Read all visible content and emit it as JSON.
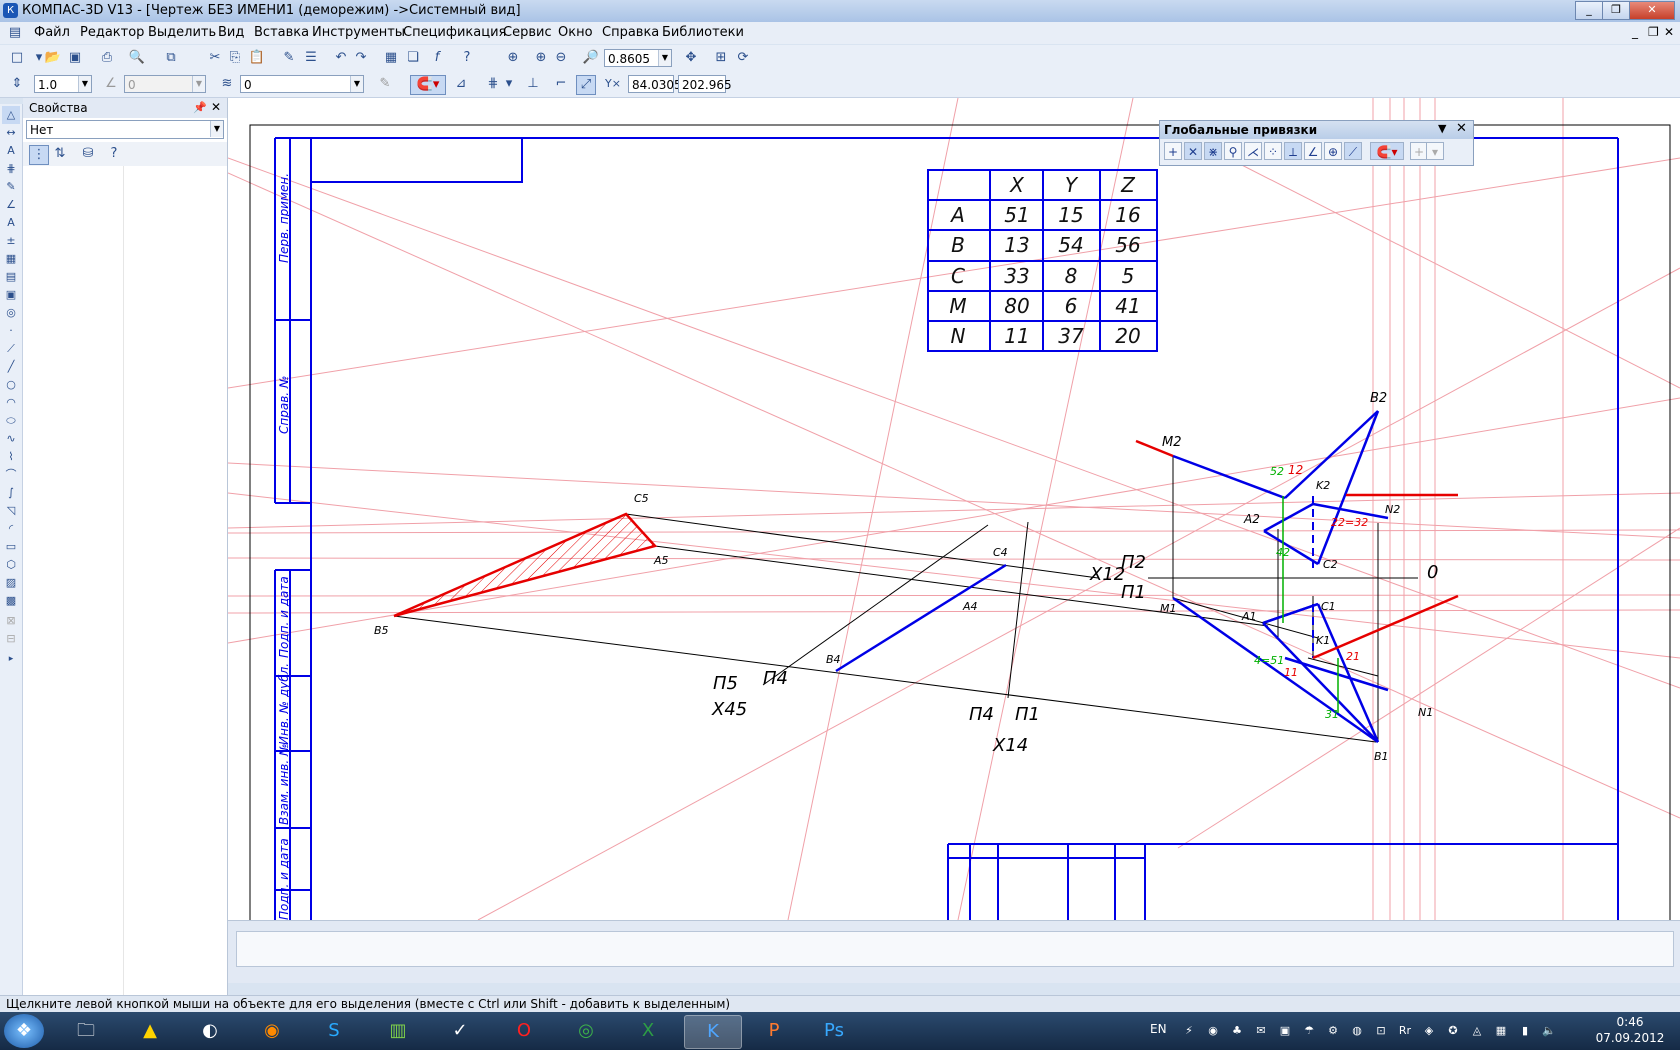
{
  "window": {
    "title": "КОМПАС-3D V13 - [Чертеж БЕЗ ИМЕНИ1 (деморежим) ->Системный вид]",
    "app_icon": "К",
    "buttons": [
      "_",
      "❐",
      "✕"
    ]
  },
  "menu": {
    "items": [
      "Файл",
      "Редактор",
      "Выделить",
      "Вид",
      "Вставка",
      "Инструменты",
      "Спецификация",
      "Сервис",
      "Окно",
      "Справка",
      "Библиотеки"
    ],
    "mdi_controls": [
      "_",
      "❐",
      "✕"
    ]
  },
  "toolbar_standard": {
    "zoom_value": "0.8605"
  },
  "toolbar_current": {
    "step_value": "1.0",
    "angle_value": "0",
    "layer_value": "0",
    "coord_x": "84.0305",
    "coord_y": "202.965",
    "coord_label": "Y"
  },
  "properties_panel": {
    "title": "Свойства",
    "combo_value": "Нет",
    "pin_icon": "ф",
    "close_icon": "✕"
  },
  "snap_panel": {
    "title": "Глобальные привязки"
  },
  "coord_table": {
    "headers": [
      "",
      "X",
      "Y",
      "Z"
    ],
    "rows": [
      [
        "A",
        "51",
        "15",
        "16"
      ],
      [
        "B",
        "13",
        "54",
        "56"
      ],
      [
        "C",
        "33",
        "8",
        "5"
      ],
      [
        "M",
        "80",
        "6",
        "41"
      ],
      [
        "N",
        "11",
        "37",
        "20"
      ]
    ]
  },
  "frame_labels": {
    "perv_primen": "Перв. примен.",
    "sprav": "Справ. №",
    "podp_data": "Подп. и дата",
    "inv_dubl": "Инв. № дубл.",
    "vzam_inv": "Взам. инв. №",
    "podp_data2": "Подп. и дата"
  },
  "drawing_labels": {
    "B2": "B2",
    "M2": "M2",
    "K2": "K2",
    "N2": "N2",
    "A2": "A2",
    "C2": "C2",
    "n52": "52",
    "n12": "12",
    "n42": "42",
    "n22": "22=32",
    "X12": "X12",
    "P2": "П2",
    "P1": "П1",
    "O": "0",
    "M1": "M1",
    "A1": "A1",
    "C1": "C1",
    "K1": "K1",
    "B1": "B1",
    "N1": "N1",
    "n41": "4=51",
    "n11": "11",
    "n21": "21",
    "n31": "31",
    "C5": "C5",
    "A5": "A5",
    "B5": "B5",
    "C4": "C4",
    "A4": "A4",
    "B4": "B4",
    "P5": "П5",
    "P4a": "П4",
    "X45": "X45",
    "P4b": "П4",
    "P1b": "П1",
    "X14": "X14"
  },
  "status_text": "Щелкните левой кнопкой мыши на объекте для его выделения (вместе с Ctrl или Shift - добавить к выделенным)",
  "taskbar": {
    "language": "EN",
    "time": "0:46",
    "date": "07.09.2012"
  },
  "colors": {
    "frame": "#0000e6",
    "red": "#e60000",
    "aux": "#f0a0a8",
    "green": "#00b000"
  }
}
